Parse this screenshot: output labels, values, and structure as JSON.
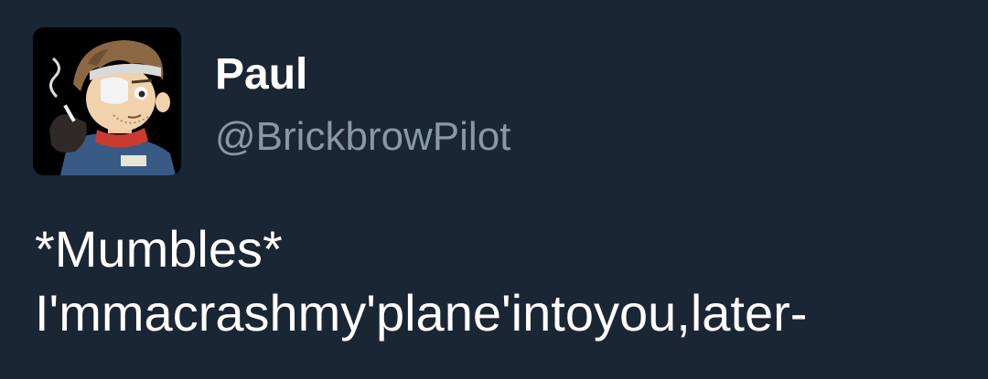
{
  "user": {
    "display_name": "Paul",
    "handle": "@BrickbrowPilot",
    "avatar": "avatar-cartoon-pilot-with-eyepatch"
  },
  "tweet": {
    "lines": [
      "*Mumbles*",
      "I'mmacrashmy'plane'intoyou,later-"
    ]
  },
  "colors": {
    "background": "#1b2634",
    "name": "#ffffff",
    "handle": "#8899a6",
    "text": "#ffffff"
  }
}
